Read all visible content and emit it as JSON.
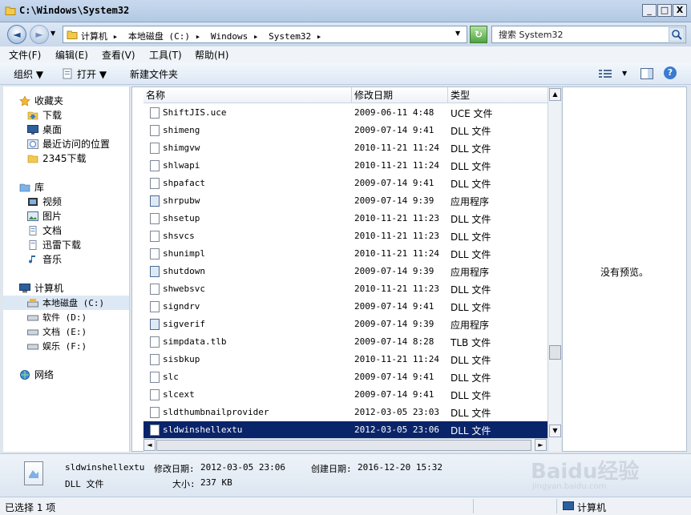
{
  "window": {
    "title": "C:\\Windows\\System32",
    "buttons": {
      "minimize": "_",
      "maximize": "□",
      "close": "X"
    }
  },
  "nav": {
    "back": "◄",
    "forward": "►"
  },
  "address": {
    "crumbs": [
      "计算机 ▸",
      "本地磁盘 (C:) ▸",
      "Windows ▸",
      "System32 ▸"
    ],
    "dropdown": "▼"
  },
  "search": {
    "placeholder": "搜索 System32"
  },
  "menu": [
    "文件(F)",
    "编辑(E)",
    "查看(V)",
    "工具(T)",
    "帮助(H)"
  ],
  "toolbar": {
    "organize": "组织 ▼",
    "open": "打开 ▼",
    "new_folder": "新建文件夹",
    "view_arrow": "▼",
    "help": "?"
  },
  "sidebar": {
    "favorites": "收藏夹",
    "fav_items": [
      "下载",
      "桌面",
      "最近访问的位置",
      "2345下载"
    ],
    "library": "库",
    "lib_items": [
      "视频",
      "图片",
      "文档",
      "迅雷下载",
      "音乐"
    ],
    "computer": "计算机",
    "drives": [
      "本地磁盘 (C:)",
      "软件 (D:)",
      "文档 (E:)",
      "娱乐 (F:)"
    ],
    "network": "网络"
  },
  "columns": {
    "name": "名称",
    "modified": "修改日期",
    "type": "类型"
  },
  "files": [
    {
      "name": "ShiftJIS.uce",
      "date": "2009-06-11 4:48",
      "type": "UCE 文件"
    },
    {
      "name": "shimeng",
      "date": "2009-07-14 9:41",
      "type": "DLL 文件"
    },
    {
      "name": "shimgvw",
      "date": "2010-11-21 11:24",
      "type": "DLL 文件"
    },
    {
      "name": "shlwapi",
      "date": "2010-11-21 11:24",
      "type": "DLL 文件"
    },
    {
      "name": "shpafact",
      "date": "2009-07-14 9:41",
      "type": "DLL 文件"
    },
    {
      "name": "shrpubw",
      "date": "2009-07-14 9:39",
      "type": "应用程序"
    },
    {
      "name": "shsetup",
      "date": "2010-11-21 11:23",
      "type": "DLL 文件"
    },
    {
      "name": "shsvcs",
      "date": "2010-11-21 11:23",
      "type": "DLL 文件"
    },
    {
      "name": "shunimpl",
      "date": "2010-11-21 11:24",
      "type": "DLL 文件"
    },
    {
      "name": "shutdown",
      "date": "2009-07-14 9:39",
      "type": "应用程序"
    },
    {
      "name": "shwebsvc",
      "date": "2010-11-21 11:23",
      "type": "DLL 文件"
    },
    {
      "name": "signdrv",
      "date": "2009-07-14 9:41",
      "type": "DLL 文件"
    },
    {
      "name": "sigverif",
      "date": "2009-07-14 9:39",
      "type": "应用程序"
    },
    {
      "name": "simpdata.tlb",
      "date": "2009-07-14 8:28",
      "type": "TLB 文件"
    },
    {
      "name": "sisbkup",
      "date": "2010-11-21 11:24",
      "type": "DLL 文件"
    },
    {
      "name": "slc",
      "date": "2009-07-14 9:41",
      "type": "DLL 文件"
    },
    {
      "name": "slcext",
      "date": "2009-07-14 9:41",
      "type": "DLL 文件"
    },
    {
      "name": "sldthumbnailprovider",
      "date": "2012-03-05 23:03",
      "type": "DLL 文件"
    },
    {
      "name": "sldwinshellextu",
      "date": "2012-03-05 23:06",
      "type": "DLL 文件"
    }
  ],
  "preview": {
    "text": "没有预览。"
  },
  "details": {
    "filename": "sldwinshellextu",
    "modified_label": "修改日期:",
    "modified": "2012-03-05 23:06",
    "created_label": "创建日期:",
    "created": "2016-12-20 15:32",
    "type": "DLL 文件",
    "size_label": "大小:",
    "size": "237 KB"
  },
  "status": {
    "left": "已选择 1 项",
    "right": "计算机"
  },
  "watermark": {
    "text": "Baidu经验",
    "sub": "jingyan.baidu.com"
  }
}
